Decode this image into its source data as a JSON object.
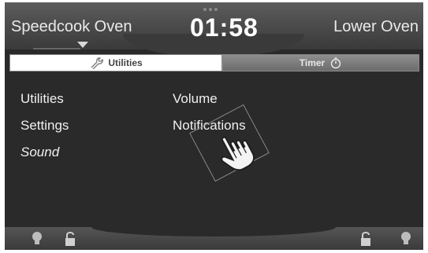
{
  "header": {
    "left_title": "Speedcook Oven",
    "right_title": "Lower Oven",
    "clock": "01:58"
  },
  "tabs": [
    {
      "label": "Utilities",
      "icon": "wrench-icon",
      "active": true
    },
    {
      "label": "Timer",
      "icon": "stopwatch-icon",
      "active": false
    }
  ],
  "menu": {
    "items": [
      "Utilities",
      "Settings",
      "Sound"
    ],
    "active": "Sound"
  },
  "submenu": {
    "items": [
      "Volume",
      "Notifications"
    ]
  },
  "footer": {
    "icons": [
      "lightbulb-icon",
      "unlock-icon",
      "unlock-icon",
      "lightbulb-icon"
    ]
  }
}
